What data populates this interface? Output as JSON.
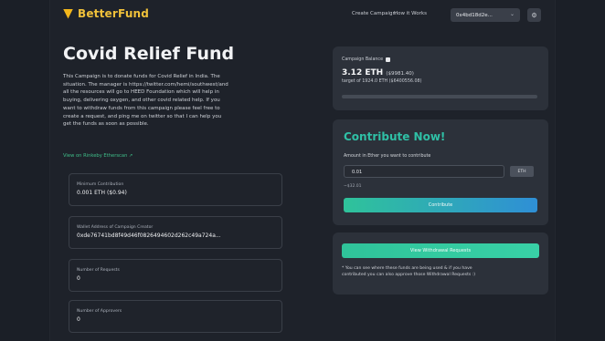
{
  "nav": {
    "logo": "BetterFund",
    "create_campaign": "Create Campaign",
    "how_it_works": "How it Works",
    "wallet": "0x4bd18d2e...",
    "settings_icon": "gear-icon"
  },
  "campaign": {
    "title": "Covid Relief Fund",
    "description_lines": [
      "This Campaign is to donate funds for Covid Relief in India. The",
      "situation. The manager is https://twitter.com/hemi/southwest/and",
      "all the resources will go to HEED Foundation which will help in",
      "buying, delivering oxygen, and other covid related help. If you",
      "want to withdraw funds from this campaign please feel free to",
      "create a request, and ping me on twitter so that I can help you",
      "get the funds as soon as possible."
    ],
    "etherscan_link": "View on Rinkeby Etherscan ↗"
  },
  "stats": [
    {
      "label": "Minimum Contribution",
      "value": "0.001 ETH ($0.94)"
    },
    {
      "label": "Wallet Address of Campaign Creator",
      "value": "0xde76741bd8f49d46f0826494602d262c49a724a..."
    },
    {
      "label": "Number of Requests",
      "value": "0"
    },
    {
      "label": "Number of Approvers",
      "value": "0"
    }
  ],
  "balance": {
    "label": "Campaign Balance",
    "amount": "3.12 ETH",
    "amount_usd": "($9981.40)",
    "target": "target of 1924.0 ETH ($6400556.08)",
    "progress_fraction": 0.002
  },
  "contribute": {
    "heading": "Contribute Now!",
    "amount_label": "Amount in Ether you want to contribute",
    "amount_value": "0.01",
    "unit": "ETH",
    "usd_value": "~$32.01",
    "button": "Contribute"
  },
  "requests": {
    "button": "View Withdrawal Requests",
    "note_lines": [
      "* You can see where these funds are being used & if you have",
      "contributed you can also approve those Withdrawal Requests :)"
    ]
  }
}
